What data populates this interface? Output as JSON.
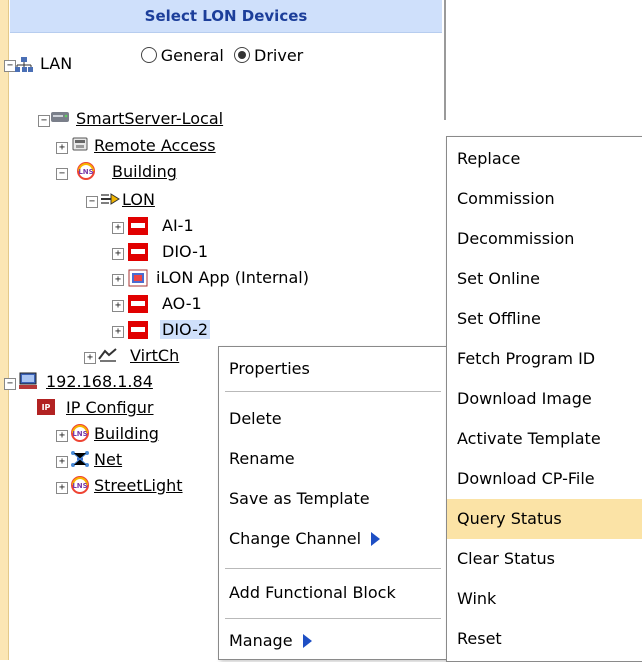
{
  "panel": {
    "title": "Select LON Devices"
  },
  "view_mode": {
    "options": [
      "General",
      "Driver"
    ],
    "selected": "Driver"
  },
  "tree": [
    {
      "label": "LAN",
      "toggle": "−",
      "icon": "network-icon"
    },
    {
      "label": "SmartServer-Local",
      "toggle": "−",
      "icon": "server-icon"
    },
    {
      "label": "Remote Access",
      "toggle": "+",
      "icon": "phone-icon"
    },
    {
      "label": "Building",
      "toggle": "−",
      "icon": "lns-icon"
    },
    {
      "label": "LON",
      "toggle": "−",
      "icon": "channel-icon"
    },
    {
      "label": "AI-1",
      "toggle": "+",
      "icon": "device-icon"
    },
    {
      "label": "DIO-1",
      "toggle": "+",
      "icon": "device-icon"
    },
    {
      "label": "iLON App (Internal)",
      "toggle": "+",
      "icon": "app-icon"
    },
    {
      "label": "AO-1",
      "toggle": "+",
      "icon": "device-icon"
    },
    {
      "label": "DIO-2",
      "toggle": "+",
      "icon": "device-icon"
    },
    {
      "label": "VirtCh",
      "toggle": "+",
      "icon": "virtual-channel-icon"
    },
    {
      "label": "192.168.1.84",
      "toggle": "−",
      "icon": "computer-icon"
    },
    {
      "label": "IP Configur",
      "toggle": "",
      "icon": "ip-config-icon"
    },
    {
      "label": "Building",
      "toggle": "+",
      "icon": "lns-icon"
    },
    {
      "label": "Net",
      "toggle": "+",
      "icon": "net-icon"
    },
    {
      "label": "StreetLight",
      "toggle": "+",
      "icon": "lns-icon"
    }
  ],
  "context_menu": {
    "items": [
      "Properties",
      "Delete",
      "Rename",
      "Save as Template",
      "Change Channel",
      "Add Functional Block",
      "Manage"
    ]
  },
  "submenu": {
    "items": [
      "Replace",
      "Commission",
      "Decommission",
      "Set Online",
      "Set Offline",
      "Fetch Program ID",
      "Download Image",
      "Activate Template",
      "Download CP-File",
      "Query Status",
      "Clear Status",
      "Wink",
      "Reset"
    ],
    "highlighted": "Query Status"
  },
  "colors": {
    "header_bg": "#cfe0fb",
    "highlight": "#fbe3a6",
    "left_strip": "#fbe6b4"
  }
}
